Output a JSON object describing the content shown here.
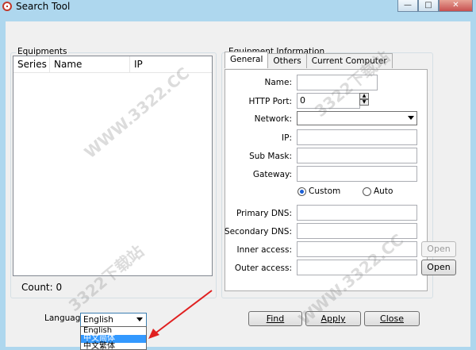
{
  "window": {
    "title": "Search Tool",
    "min_glyph": "—",
    "max_glyph": "□",
    "close_glyph": "✕"
  },
  "equipments": {
    "group_label": "Equipments",
    "columns": [
      "Series",
      "Name",
      "IP"
    ],
    "count_label": "Count: 0"
  },
  "info": {
    "group_label": "Equipment Information",
    "tabs": [
      "General",
      "Others",
      "Current Computer"
    ],
    "active_tab": "General",
    "fields": {
      "name_label": "Name:",
      "name_value": "",
      "http_port_label": "HTTP Port:",
      "http_port_value": "0",
      "network_label": "Network:",
      "network_value": "",
      "ip_label": "IP:",
      "submask_label": "Sub Mask:",
      "gateway_label": "Gateway:",
      "custom_label": "Custom",
      "auto_label": "Auto",
      "dns_mode": "Custom",
      "primary_dns_label": "Primary DNS:",
      "secondary_dns_label": "Secondary DNS:",
      "inner_access_label": "Inner access:",
      "outer_access_label": "Outer access:",
      "open_label": "Open"
    }
  },
  "language": {
    "label": "Language",
    "selected": "English",
    "options": [
      "English",
      "中文简体",
      "中文繁体"
    ],
    "highlighted": "中文简体"
  },
  "buttons": {
    "find": "Find",
    "apply": "Apply",
    "close": "Close"
  },
  "watermark": {
    "text": "WWW.3322.CC",
    "text_cn": "3322下载站"
  },
  "colors": {
    "frame": "#aed7ee",
    "client": "#f0f0f0",
    "selection": "#3399ff",
    "annotation_arrow": "#e02020"
  }
}
